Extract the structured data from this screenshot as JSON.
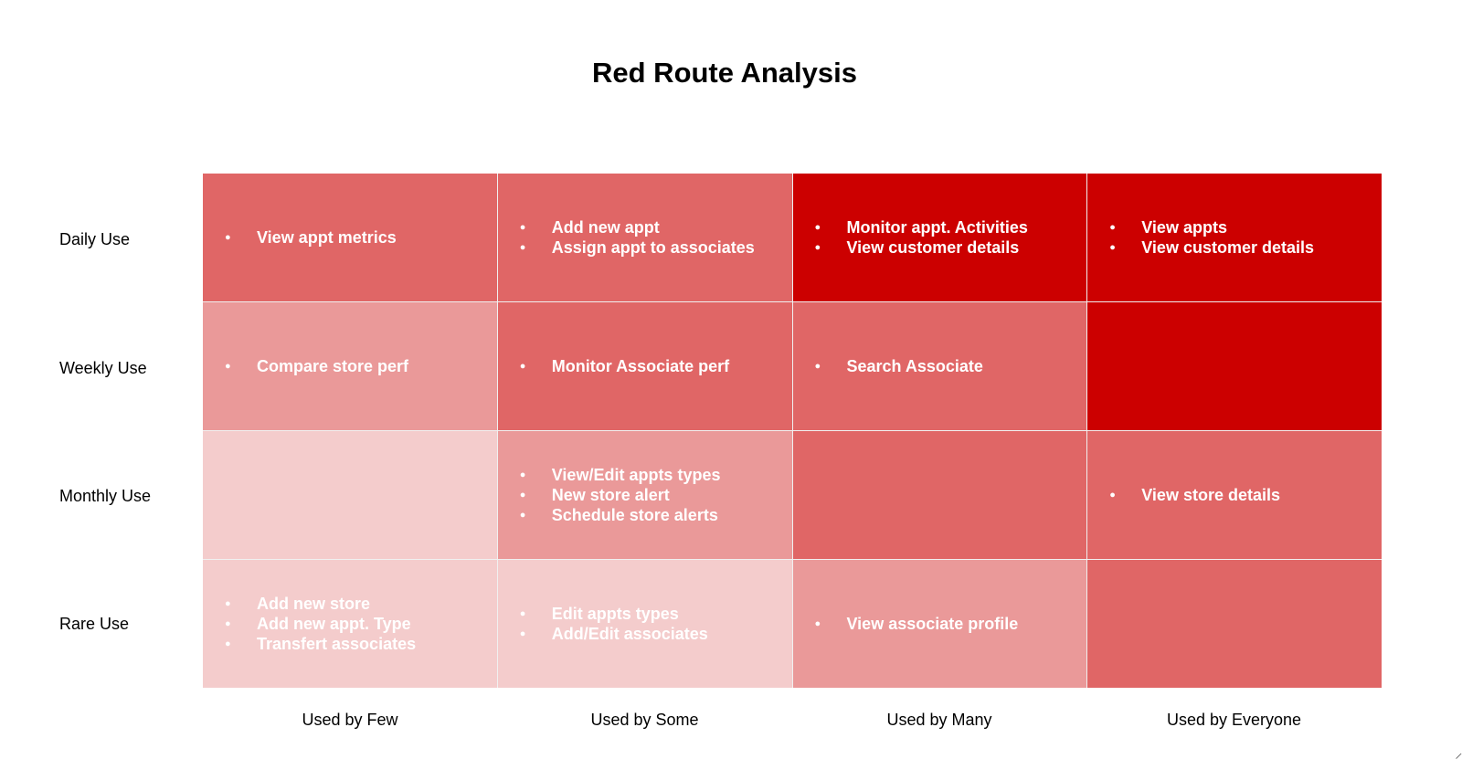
{
  "title": "Red Route Analysis",
  "colors": {
    "intense": "#cc0000",
    "strong": "#e06666",
    "medium": "#ea9999",
    "light": "#f4cccc",
    "text": "#ffffff"
  },
  "rows": [
    "Daily Use",
    "Weekly Use",
    "Monthly Use",
    "Rare Use"
  ],
  "columns": [
    "Used by Few",
    "Used by Some",
    "Used by Many",
    "Used by Everyone"
  ],
  "cells": [
    [
      {
        "level": "strong",
        "items": [
          "View appt metrics"
        ]
      },
      {
        "level": "strong",
        "items": [
          "Add new appt",
          "Assign appt to associates"
        ]
      },
      {
        "level": "intense",
        "items": [
          "Monitor appt. Activities",
          "View customer details"
        ]
      },
      {
        "level": "intense",
        "items": [
          "View appts",
          "View customer details"
        ]
      }
    ],
    [
      {
        "level": "medium",
        "items": [
          "Compare store perf"
        ]
      },
      {
        "level": "strong",
        "items": [
          "Monitor Associate perf"
        ]
      },
      {
        "level": "strong",
        "items": [
          "Search Associate"
        ]
      },
      {
        "level": "intense",
        "items": []
      }
    ],
    [
      {
        "level": "light",
        "items": []
      },
      {
        "level": "medium",
        "items": [
          "View/Edit appts types",
          "New store alert",
          "Schedule store alerts"
        ]
      },
      {
        "level": "strong",
        "items": []
      },
      {
        "level": "strong",
        "items": [
          "View store details"
        ]
      }
    ],
    [
      {
        "level": "light",
        "items": [
          "Add new store",
          "Add new appt. Type",
          "Transfert associates"
        ]
      },
      {
        "level": "light",
        "items": [
          "Edit appts types",
          "Add/Edit associates"
        ]
      },
      {
        "level": "medium",
        "items": [
          "View associate profile"
        ]
      },
      {
        "level": "strong",
        "items": []
      }
    ]
  ]
}
